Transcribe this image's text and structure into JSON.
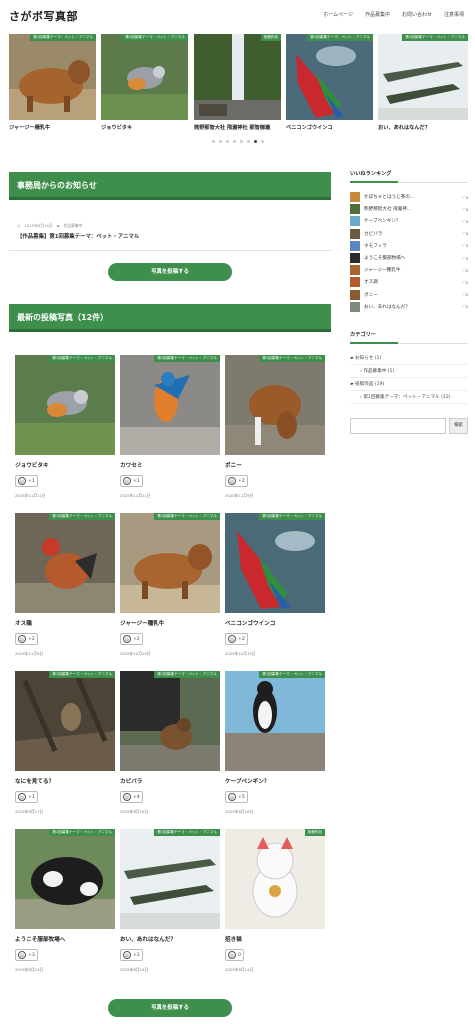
{
  "site": {
    "logo": "さがボ写真部"
  },
  "nav": [
    "ホームページ",
    "作品募集中",
    "お問い合わせ",
    "注意事項"
  ],
  "slider": {
    "slides": [
      {
        "tag": "第1回募集テーマ：ペット・アニマル",
        "caption": "ジャージー種乳牛"
      },
      {
        "tag": "第1回募集テーマ：ペット・アニマル",
        "caption": "ジョウビタキ"
      },
      {
        "tag": "投稿作品",
        "caption": "熊野那智大社 飛瀧神社 那智御瀧"
      },
      {
        "tag": "第1回募集テーマ：ペット・アニマル",
        "caption": "ベニコンゴウインコ"
      },
      {
        "tag": "第1回募集テーマ：ペット・アニマル",
        "caption": "おい、あれはなんだ？"
      }
    ],
    "dots": 8,
    "active_dot": 6
  },
  "news": {
    "heading": "事務局からのお知らせ",
    "date": "2025年8月14日",
    "category": "作品募集中",
    "title": "【作品募集】第1回募集テーマ：ペット・アニマル",
    "button": "写真を投稿する"
  },
  "latest": {
    "heading": "最新の投稿写真（12件）",
    "button": "写真を投稿する",
    "posts": [
      {
        "tag": "第1回募集テーマ・ペット・アニマル",
        "title": "ジョウビタキ",
        "likes": "+1",
        "date": "2025年11月11日"
      },
      {
        "tag": "第1回募集テーマ・ペット・アニマル",
        "title": "カワセミ",
        "likes": "+1",
        "date": "2025年11月11日"
      },
      {
        "tag": "第1回募集テーマ・ペット・アニマル",
        "title": "ポニー",
        "likes": "+2",
        "date": "2025年11月9日"
      },
      {
        "tag": "第1回募集テーマ・ペット・アニマル",
        "title": "オス鶏",
        "likes": "+2",
        "date": "2025年11月9日"
      },
      {
        "tag": "第1回募集テーマ・ペット・アニマル",
        "title": "ジャージー種乳牛",
        "likes": "+2",
        "date": "2025年10月20日"
      },
      {
        "tag": "第1回募集テーマ・ペット・アニマル",
        "title": "ベニコンゴウインコ",
        "likes": "+2",
        "date": "2025年10月15日"
      },
      {
        "tag": "第1回募集テーマ・ペット・アニマル",
        "title": "なにを見てる？",
        "likes": "+1",
        "date": "2025年9月17日"
      },
      {
        "tag": "第1回募集テーマ・ペット・アニマル",
        "title": "カピバラ",
        "likes": "+4",
        "date": "2025年8月18日"
      },
      {
        "tag": "第1回募集テーマ・ペット・アニマル",
        "title": "ケープペンギン？",
        "likes": "+5",
        "date": "2025年8月18日"
      },
      {
        "tag": "第1回募集テーマ・ペット・アニマル",
        "title": "ようこそ服部牧場へ",
        "likes": "+3",
        "date": "2025年8月14日"
      },
      {
        "tag": "第1回募集テーマ・ペット・アニマル",
        "title": "おい、あれはなんだ？",
        "likes": "+2",
        "date": "2025年8月14日"
      },
      {
        "tag": "投稿作品",
        "title": "招き猫",
        "likes": "0",
        "date": "2025年8月14日"
      }
    ]
  },
  "sidebar": {
    "ranking_heading": "いいねランキング",
    "ranking": [
      {
        "name": "かぼちゃとほうじ茶の…",
        "count": "4"
      },
      {
        "name": "熊野那智大社 飛瀧神…",
        "count": "4"
      },
      {
        "name": "ケープペンギン？",
        "count": "4"
      },
      {
        "name": "カピバラ",
        "count": "4"
      },
      {
        "name": "ネモフィラ",
        "count": "3"
      },
      {
        "name": "ようこそ服部牧場へ",
        "count": "3"
      },
      {
        "name": "ジャージー種乳牛",
        "count": "2"
      },
      {
        "name": "オス鶏",
        "count": "2"
      },
      {
        "name": "ポニー",
        "count": "2"
      },
      {
        "name": "おい、あれはなんだ？",
        "count": "2"
      }
    ],
    "category_heading": "カテゴリー",
    "categories": [
      {
        "label": "お知らせ",
        "count": "(1)",
        "sub": false
      },
      {
        "label": "作品募集中",
        "count": "(1)",
        "sub": true
      },
      {
        "label": "投稿作品",
        "count": "(19)",
        "sub": false
      },
      {
        "label": "第1回募集テーマ：ペット・アニマル",
        "count": "(12)",
        "sub": true
      }
    ],
    "search_button": "検索"
  },
  "colors": {
    "accent": "#3d8f4b",
    "accent_dark": "#2b6e37"
  }
}
